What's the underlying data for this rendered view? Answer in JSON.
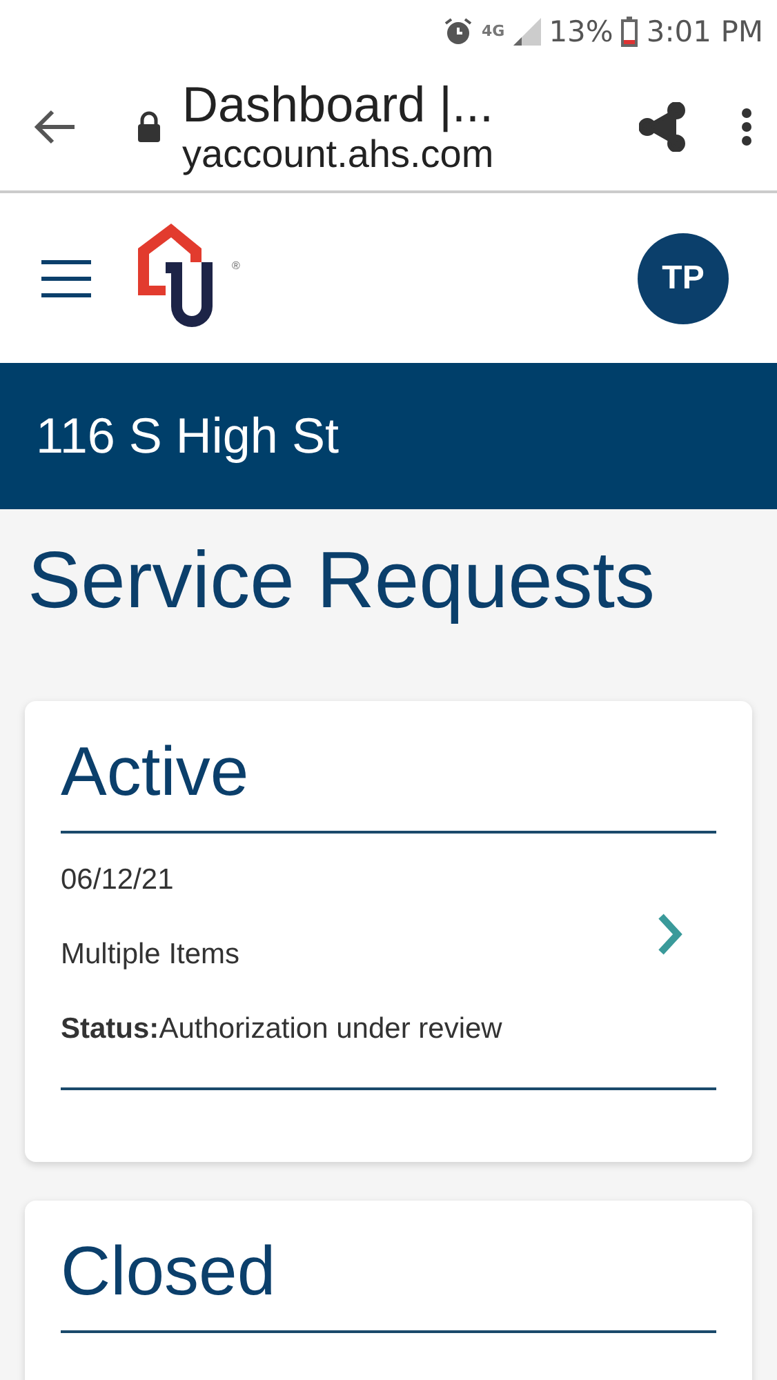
{
  "status_bar": {
    "network": "4G",
    "battery": "13%",
    "time": "3:01 PM"
  },
  "browser": {
    "title": "Dashboard |...",
    "url": "yaccount.ahs.com"
  },
  "header": {
    "avatar": "TP",
    "registered_mark": "®"
  },
  "property": {
    "address": "116 S High St"
  },
  "page_title": "Service Requests",
  "sections": [
    {
      "title": "Active",
      "requests": [
        {
          "date": "06/12/21",
          "description": "Multiple Items",
          "status": "**Status:**Authorization under review"
        }
      ]
    },
    {
      "title": "Closed"
    }
  ]
}
